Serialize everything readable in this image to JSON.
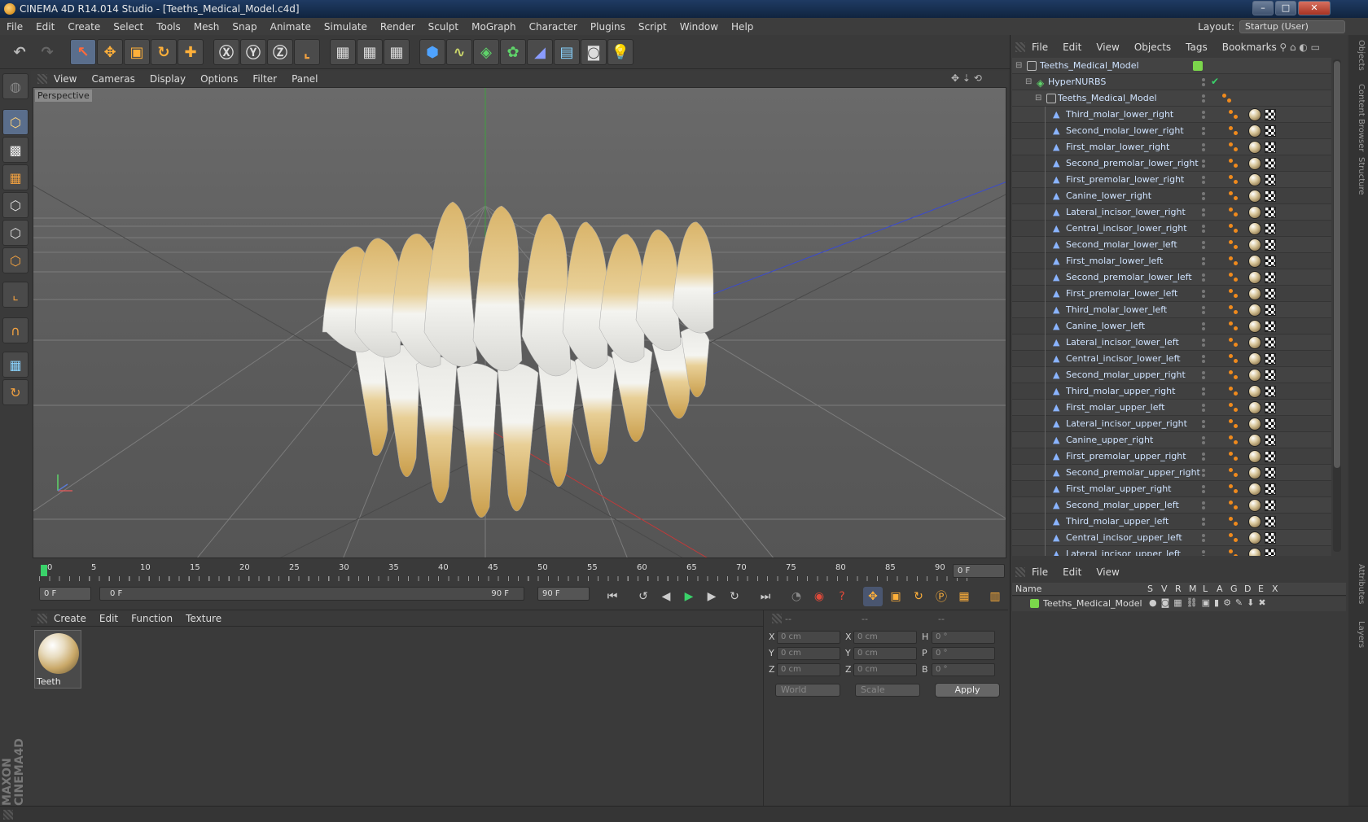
{
  "window": {
    "title": "CINEMA 4D R14.014 Studio - [Teeths_Medical_Model.c4d]",
    "minimize_glyph": "–",
    "maximize_glyph": "□",
    "close_glyph": "✕"
  },
  "menu": [
    "File",
    "Edit",
    "Create",
    "Select",
    "Tools",
    "Mesh",
    "Snap",
    "Animate",
    "Simulate",
    "Render",
    "Sculpt",
    "MoGraph",
    "Character",
    "Plugins",
    "Script",
    "Window",
    "Help"
  ],
  "layout": {
    "label": "Layout:",
    "value": "Startup (User)"
  },
  "viewport": {
    "menu": [
      "View",
      "Cameras",
      "Display",
      "Options",
      "Filter",
      "Panel"
    ],
    "label": "Perspective"
  },
  "timeline": {
    "ticks": [
      "0",
      "5",
      "10",
      "15",
      "20",
      "25",
      "30",
      "35",
      "40",
      "45",
      "50",
      "55",
      "60",
      "65",
      "70",
      "75",
      "80",
      "85",
      "90"
    ],
    "current_frame": "0 F"
  },
  "transport": {
    "start": "0 F",
    "range_start": "0 F",
    "range_end": "90 F",
    "end": "90 F"
  },
  "materials": {
    "menu": [
      "Create",
      "Edit",
      "Function",
      "Texture"
    ],
    "items": [
      {
        "name": "Teeth"
      }
    ]
  },
  "coords": {
    "headers": [
      "--",
      "--",
      "--"
    ],
    "rows": [
      {
        "l1": "X",
        "v1": "0 cm",
        "l2": "X",
        "v2": "0 cm",
        "l3": "H",
        "v3": "0 °"
      },
      {
        "l1": "Y",
        "v1": "0 cm",
        "l2": "Y",
        "v2": "0 cm",
        "l3": "P",
        "v3": "0 °"
      },
      {
        "l1": "Z",
        "v1": "0 cm",
        "l2": "Z",
        "v2": "0 cm",
        "l3": "B",
        "v3": "0 °"
      }
    ],
    "coord_mode": "World",
    "size_mode": "Scale",
    "apply": "Apply"
  },
  "objects": {
    "menu": [
      "File",
      "Edit",
      "View",
      "Objects",
      "Tags",
      "Bookmarks"
    ],
    "root": "Teeths_Medical_Model",
    "hypernurbs": "HyperNURBS",
    "group": "Teeths_Medical_Model",
    "items": [
      "Third_molar_lower_right",
      "Second_molar_lower_right",
      "First_molar_lower_right",
      "Second_premolar_lower_right",
      "First_premolar_lower_right",
      "Canine_lower_right",
      "Lateral_incisor_lower_right",
      "Central_incisor_lower_right",
      "Second_molar_lower_left",
      "First_molar_lower_left",
      "Second_premolar_lower_left",
      "First_premolar_lower_left",
      "Third_molar_lower_left",
      "Canine_lower_left",
      "Lateral_incisor_lower_left",
      "Central_incisor_lower_left",
      "Second_molar_upper_right",
      "Third_molar_upper_right",
      "First_molar_upper_left",
      "Lateral_incisor_upper_right",
      "Canine_upper_right",
      "First_premolar_upper_right",
      "Second_premolar_upper_right",
      "First_molar_upper_right",
      "Second_molar_upper_left",
      "Third_molar_upper_left",
      "Central_incisor_upper_left",
      "Lateral_incisor_upper_left"
    ]
  },
  "layers": {
    "menu": [
      "File",
      "Edit",
      "View"
    ],
    "columns": {
      "name": "Name",
      "flags": [
        "S",
        "V",
        "R",
        "M",
        "L",
        "A",
        "G",
        "D",
        "E",
        "X"
      ]
    },
    "items": [
      {
        "name": "Teeths_Medical_Model",
        "color": "#7bd64b"
      }
    ]
  },
  "side_tabs": [
    "Objects",
    "Content Browser",
    "Structure",
    "Attributes",
    "Layers"
  ],
  "brand": "MAXON CINEMA4D",
  "colors": {
    "accent": "#5a6e8c",
    "object_text": "#cfe3ff",
    "tooth_enamel": "#f2f2ee",
    "tooth_root": "#d9b46a"
  }
}
